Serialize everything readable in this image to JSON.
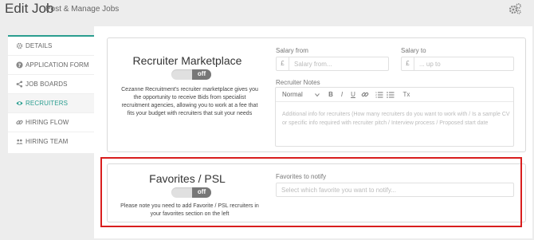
{
  "header": {
    "title": "Edit Job",
    "subtitle": "Post & Manage Jobs",
    "settings_icon": "gears-icon"
  },
  "colors": {
    "accent": "#2a9d8f",
    "highlight": "#d91e1e",
    "toggle_knob": "#777777"
  },
  "sidebar": {
    "items": [
      {
        "label": "DETAILS",
        "icon": "gear-icon",
        "active": false
      },
      {
        "label": "APPLICATION FORM",
        "icon": "question-circle-icon",
        "active": false
      },
      {
        "label": "JOB BOARDS",
        "icon": "share-icon",
        "active": false
      },
      {
        "label": "RECRUITERS",
        "icon": "eye-icon",
        "active": true
      },
      {
        "label": "HIRING FLOW",
        "icon": "link-icon",
        "active": false
      },
      {
        "label": "HIRING TEAM",
        "icon": "users-icon",
        "active": false
      }
    ]
  },
  "marketplace": {
    "title": "Recruiter Marketplace",
    "toggle_state": "off",
    "description": "Cezanne Recruitment's recruiter marketplace gives you the opportunity to receive Bids from specialist recruitment agencies, allowing you to work at a fee that fits your budget with recruiters that suit your needs",
    "salary_from": {
      "label": "Salary from",
      "addon": "£",
      "placeholder": "Salary from..."
    },
    "salary_to": {
      "label": "Salary to",
      "addon": "£",
      "placeholder": "... up to"
    },
    "notes": {
      "label": "Recruiter Notes",
      "format_select": "Normal",
      "toolbar": [
        "B",
        "I",
        "U",
        "link",
        "ol",
        "ul",
        "Tx"
      ],
      "placeholder": "Additional info for recruiters (How many recruiters do you want to work with / Is a sample CV or specific info required with recruiter pitch / Interview process / Proposed start date"
    }
  },
  "favorites": {
    "title": "Favorites / PSL",
    "toggle_state": "off",
    "description": "Please note you need to add Favorite / PSL recruiters in your favorites section on the left",
    "notify": {
      "label": "Favorites to notify",
      "placeholder": "Select which favorite you want to notify..."
    }
  }
}
